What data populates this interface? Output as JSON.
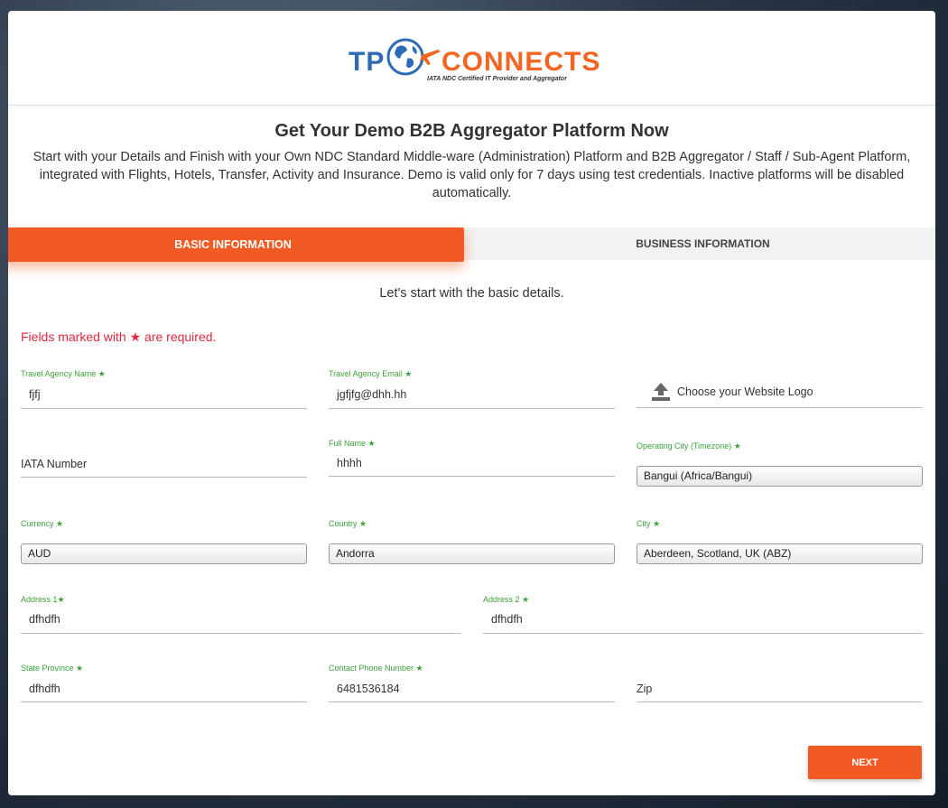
{
  "brand": {
    "logo_left": "TP",
    "logo_right": "CONNECTS",
    "tagline": "IATA NDC Certified IT Provider and Aggregator",
    "colors": {
      "blue": "#2d6cb5",
      "orange": "#f26522"
    }
  },
  "page": {
    "title": "Get Your Demo B2B Aggregator Platform Now",
    "intro": "Start with your Details and Finish with your Own NDC Standard Middle-ware (Administration) Platform and B2B Aggregator / Staff / Sub-Agent Platform, integrated with Flights, Hotels, Transfer, Activity and Insurance. Demo is valid only for 7 days using test credentials. Inactive platforms will be disabled automatically."
  },
  "tabs": {
    "active": "BASIC INFORMATION",
    "inactive": "BUSINESS INFORMATION"
  },
  "form": {
    "subtitle": "Let's start with the basic details.",
    "required_note": "Fields marked with ★ are required.",
    "agency_name": {
      "label": "Travel Agency Name ★",
      "value": "fjfj"
    },
    "agency_email": {
      "label": "Travel Agency Email ★",
      "value": "jgfjfg@dhh.hh"
    },
    "logo_upload": {
      "label": "Choose your Website Logo",
      "icon": "upload-icon"
    },
    "iata_number": {
      "placeholder": "IATA Number"
    },
    "full_name": {
      "label": "Full Name ★",
      "value": "hhhh"
    },
    "operating_city": {
      "label": "Operating City (Timezone) ★",
      "value": "Bangui (Africa/Bangui)"
    },
    "currency": {
      "label": "Currency ★",
      "value": "AUD"
    },
    "country": {
      "label": "Country ★",
      "value": "Andorra"
    },
    "city": {
      "label": "City ★",
      "value": "Aberdeen, Scotland, UK (ABZ)"
    },
    "address1": {
      "label": "Address 1★",
      "value": "dfhdfh"
    },
    "address2": {
      "label": "Address 2 ★",
      "value": "dfhdfh"
    },
    "state": {
      "label": "State Province ★",
      "value": "dfhdfh"
    },
    "phone": {
      "label": "Contact Phone Number ★",
      "value": "6481536184"
    },
    "zip": {
      "placeholder": "Zip"
    },
    "next_label": "NEXT"
  }
}
